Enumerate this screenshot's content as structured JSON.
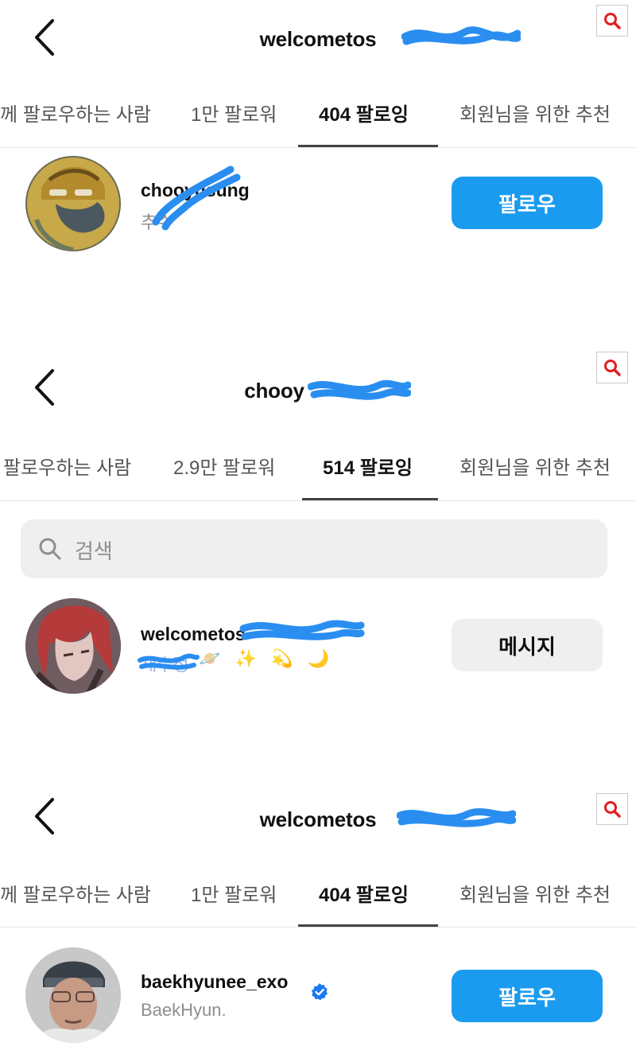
{
  "panel1": {
    "title": "welcometos",
    "tabs": [
      "께 팔로우하는 사람",
      "1만 팔로워",
      "404 팔로잉",
      "회원님을 위한 추천"
    ],
    "user": {
      "username": "chooyusung",
      "subtitle": "추수",
      "button": "팔로우"
    }
  },
  "panel2": {
    "title": "chooy",
    "tabs": [
      "팔로우하는 사람",
      "2.9만 팔로워",
      "514 팔로잉",
      "회원님을 위한 추천"
    ],
    "search_placeholder": "검색",
    "user": {
      "username": "welcometos",
      "subtitle": "채수정",
      "emojis": "🪐 ✨ 💫 🌙",
      "button": "메시지"
    }
  },
  "panel3": {
    "title": "welcometos",
    "tabs": [
      "께 팔로우하는 사람",
      "1만 팔로워",
      "404 팔로잉",
      "회원님을 위한 추천"
    ],
    "user": {
      "username": "baekhyunee_exo",
      "subtitle": "BaekHyun.",
      "verified": true,
      "button": "팔로우"
    }
  },
  "icons": {
    "back": "chevron-left-icon",
    "zoom": "magnifier-zoom-icon",
    "search": "search-icon",
    "verified": "verified-badge-icon"
  },
  "colors": {
    "follow_button": "#1a9bf0",
    "message_button": "#efefef",
    "redaction": "#2a8ef0",
    "zoom_icon": "#e02020"
  }
}
